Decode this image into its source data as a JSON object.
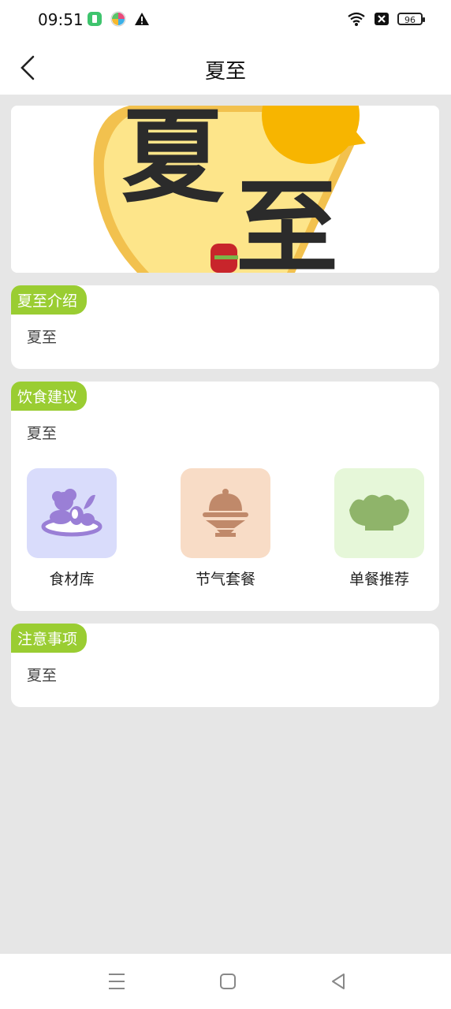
{
  "status_bar": {
    "time": "09:51",
    "battery": "96"
  },
  "header": {
    "title": "夏至"
  },
  "banner": {
    "art_text_1": "夏",
    "art_text_2": "至"
  },
  "sections": {
    "intro": {
      "tag": "夏至介绍",
      "text": "夏至"
    },
    "diet": {
      "tag": "饮食建议",
      "text": "夏至"
    },
    "notes": {
      "tag": "注意事项",
      "text": "夏至"
    }
  },
  "features": [
    {
      "label": "食材库",
      "icon": "vegetables-basket-icon",
      "bg": "#d9dcfb",
      "color": "#9a7fd6"
    },
    {
      "label": "节气套餐",
      "icon": "cloche-dish-icon",
      "bg": "#f8dcc6",
      "color": "#c0896a"
    },
    {
      "label": "单餐推荐",
      "icon": "salad-bowl-icon",
      "bg": "#e6f7d9",
      "color": "#8fb46a"
    }
  ],
  "colors": {
    "tag_bg": "#9acd32",
    "page_bg": "#e6e6e6"
  }
}
